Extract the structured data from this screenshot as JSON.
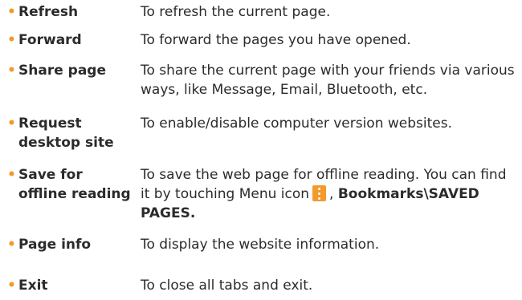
{
  "bullet_char": "•",
  "colors": {
    "bullet": "#f39a2a",
    "text": "#2b2b2b",
    "menu_icon_background": "#f39a2a"
  },
  "items": [
    {
      "term": "Refresh",
      "desc": "To refresh the current page."
    },
    {
      "term": "Forward",
      "desc": "To forward the pages you have opened."
    },
    {
      "term": "Share page",
      "desc_line1": "To share the current page with your friends via various",
      "desc_line2": "ways, like Message, Email, Bluetooth, etc."
    },
    {
      "term_line1": "Request",
      "term_line2": "desktop site",
      "desc": "To enable/disable computer version websites."
    },
    {
      "term_line1": "Save for",
      "term_line2": "offline reading",
      "desc_line1": "To save the web page for offline reading. You can find",
      "desc_line2_before_icon": "it by touching Menu icon",
      "menu_icon": "vertical-dots-menu-icon",
      "desc_line2_comma": ",",
      "bookmarks_path_line1": "Bookmarks\\SAVED",
      "bookmarks_path_line2": "PAGES."
    },
    {
      "term": "Page info",
      "desc": "To display the website information."
    },
    {
      "term": "Exit",
      "desc": "To close all tabs and exit."
    }
  ]
}
